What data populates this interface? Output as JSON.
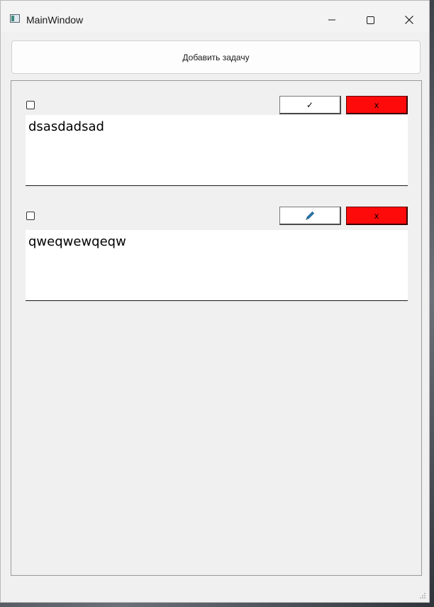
{
  "window": {
    "title": "MainWindow"
  },
  "toolbar": {
    "add_task_label": "Добавить задачу"
  },
  "tasks": [
    {
      "checked": false,
      "action_label": "✓",
      "action_icon": "check-icon",
      "delete_label": "x",
      "text": "dsasdadsad"
    },
    {
      "checked": false,
      "action_label": "",
      "action_icon": "pen-icon",
      "delete_label": "x",
      "text": "qweqwewqeqw"
    }
  ],
  "colors": {
    "delete_button": "#ff0a0a",
    "window_bg": "#f0f0f0"
  }
}
